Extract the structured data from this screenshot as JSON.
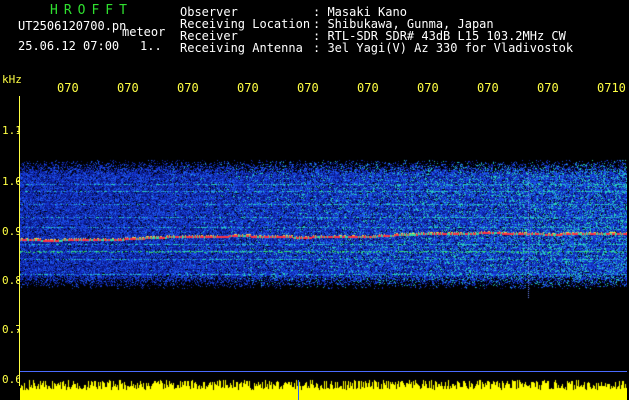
{
  "header": {
    "app_name": "HROFFT",
    "filename": "UT2506120700.pn",
    "mode": "meteor",
    "datetime": "25.06.12 07:00",
    "index": "1..",
    "fields": [
      {
        "label": "Observer",
        "value": ": Masaki Kano"
      },
      {
        "label": "Receiving Location",
        "value": ": Shibukawa, Gunma, Japan"
      },
      {
        "label": "Receiver",
        "value": ": RTL-SDR SDR# 43dB L15 103.2MHz CW"
      },
      {
        "label": "Receiving Antenna",
        "value": ": 3el Yagi(V) Az 330 for Vladivostok"
      }
    ]
  },
  "axis": {
    "unit": "kHz",
    "time_ticks": [
      "070",
      "070",
      "070",
      "070",
      "070",
      "070",
      "070",
      "070",
      "070",
      "0710"
    ],
    "freq_ticks": [
      "1.1",
      "1.0",
      "0.9",
      "0.8",
      "0.7",
      "0.6"
    ]
  },
  "colors": {
    "axis": "#ffff44",
    "title": "#2fe02f",
    "signal": "#ff3344",
    "noise_deep": "#0a1a8a",
    "noise_mid": "#1e46d8",
    "noise_high": "#2fd0c0",
    "amplitude": "#ffff00"
  }
}
